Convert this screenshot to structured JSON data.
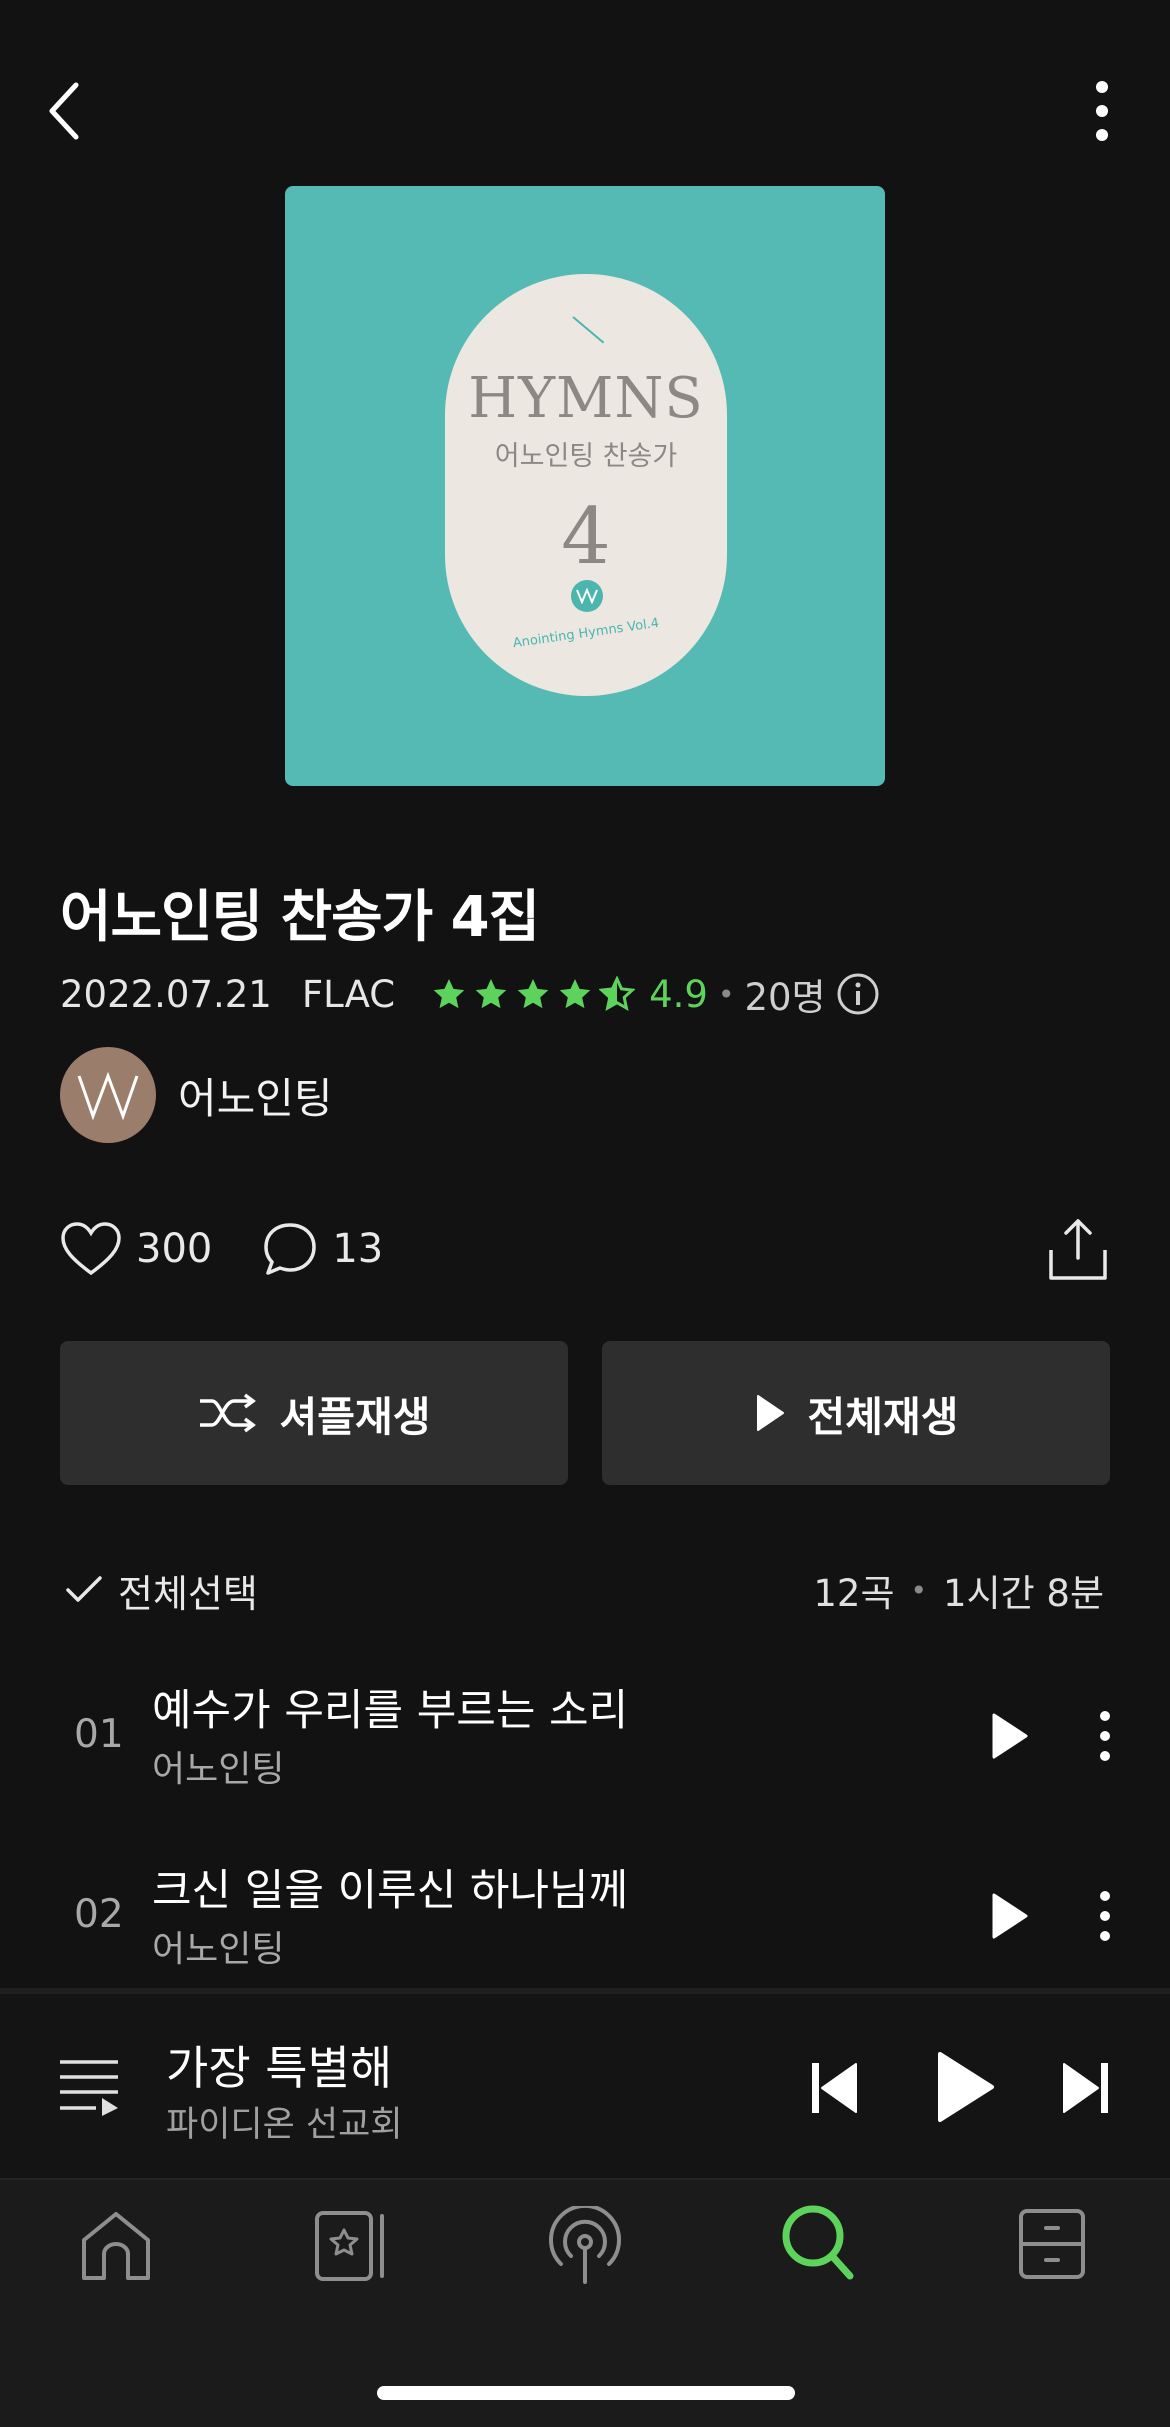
{
  "album": {
    "title": "어노인팅 찬송가 4집",
    "release_date": "2022.07.21",
    "format": "FLAC",
    "rating": "4.9",
    "rating_stars": 4.5,
    "rating_count": "20명",
    "artist": "어노인팅"
  },
  "cover": {
    "title_en": "HYMNS",
    "title_ko": "어노인팅 찬송가",
    "number": "4",
    "subtitle": "Anointing Hymns Vol.4"
  },
  "stats": {
    "likes": "300",
    "comments": "13"
  },
  "actions": {
    "shuffle_label": "셔플재생",
    "play_all_label": "전체재생"
  },
  "tracklist": {
    "select_all_label": "전체선택",
    "track_count": "12곡",
    "duration": "1시간 8분",
    "tracks": [
      {
        "number": "01",
        "title": "예수가 우리를 부르는 소리",
        "artist": "어노인팅"
      },
      {
        "number": "02",
        "title": "크신 일을 이루신 하나님께",
        "artist": "어노인팅"
      }
    ]
  },
  "now_playing": {
    "title": "가장 특별해",
    "artist": "파이디온 선교회"
  },
  "nav": {
    "items": [
      {
        "icon": "home-icon",
        "active": false
      },
      {
        "icon": "library-icon",
        "active": false
      },
      {
        "icon": "podcast-icon",
        "active": false
      },
      {
        "icon": "search-icon",
        "active": true
      },
      {
        "icon": "storage-icon",
        "active": false
      }
    ]
  },
  "colors": {
    "background": "#121212",
    "accent_green": "#5ed35c",
    "cover_teal": "#55b9b4",
    "button_bg": "#2e2e2e"
  }
}
